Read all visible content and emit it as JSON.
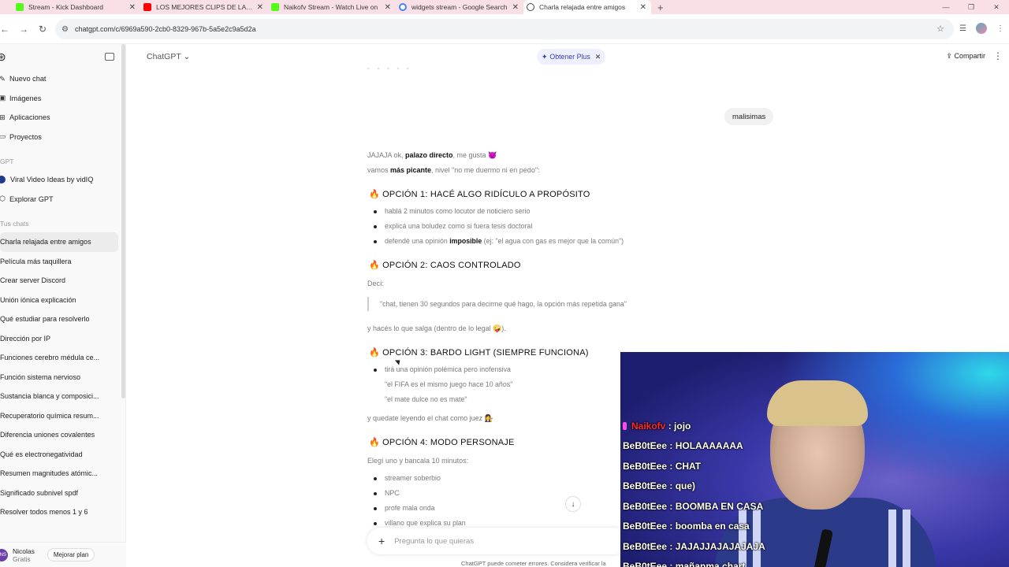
{
  "browser": {
    "tabs": [
      {
        "title": "Stream - Kick Dashboard",
        "icon": "kick-icon",
        "color": "#53fc18",
        "active": false
      },
      {
        "title": "LOS MEJORES CLIPS DE LA PXE",
        "icon": "youtube-icon",
        "color": "#ff0000",
        "active": false
      },
      {
        "title": "Naikofv Stream - Watch Live on",
        "icon": "kick-icon",
        "color": "#53fc18",
        "active": false
      },
      {
        "title": "widgets stream - Google Search",
        "icon": "google-icon",
        "color": "#4285f4",
        "active": false
      },
      {
        "title": "Charla relajada entre amigos",
        "icon": "chatgpt-icon",
        "color": "#444444",
        "active": true
      }
    ],
    "url": "chatgpt.com/c/6969a590-2cb0-8329-967b-5a5e2c9a5d2a"
  },
  "sidebar": {
    "nav": [
      {
        "label": "Nuevo chat",
        "icon": "edit-icon"
      },
      {
        "label": "Imágenes",
        "icon": "image-icon"
      },
      {
        "label": "Aplicaciones",
        "icon": "apps-icon"
      },
      {
        "label": "Proyectos",
        "icon": "folder-icon"
      }
    ],
    "gpt_section": "GPT",
    "gpts": [
      {
        "label": "Viral Video Ideas by vidIQ",
        "icon": "vidiq-icon"
      },
      {
        "label": "Explorar GPT",
        "icon": "explore-icon"
      }
    ],
    "chats_section": "Tus chats",
    "chats": [
      "Charla relajada entre amigos",
      "Película más taquillera",
      "Crear server Discord",
      "Unión iónica explicación",
      "Qué estudiar para resolverlo",
      "Dirección por IP",
      "Funciones cerebro médula ce...",
      "Función sistema nervioso",
      "Sustancia blanca y composici...",
      "Recuperatorio química resum...",
      "Diferencia uniones covalentes",
      "Qué es electronegatividad",
      "Resumen magnitudes atómic...",
      "Significado subnivel spdf",
      "Resolver todos menos 1 y 6"
    ],
    "user": {
      "name": "Nicolas",
      "plan": "Gratis",
      "initials": "NS"
    },
    "upgrade_label": "Mejorar plan"
  },
  "header": {
    "model": "ChatGPT",
    "plus_label": "Obtener Plus",
    "share_label": "Compartir"
  },
  "conversation": {
    "user_message": "malisimas",
    "intro1_a": "JAJAJA ok, ",
    "intro1_b": "palazo directo",
    "intro1_c": ", me gusta 😈",
    "intro2_a": "vamos ",
    "intro2_b": "más picante",
    "intro2_c": ", nivel \"no me duermo ni en pedo\":",
    "opt1_title": "OPCIÓN 1: HACÉ ALGO RIDÍCULO A PROPÓSITO",
    "opt1_items": [
      "hablá 2 minutos como locutor de noticiero serio",
      "explicá una boludez como si fuera tesis doctoral"
    ],
    "opt1_item3_a": "defendé una opinión ",
    "opt1_item3_b": "imposible",
    "opt1_item3_c": " (ej: \"el agua con gas es mejor que la común\")",
    "opt2_title": "OPCIÓN 2: CAOS CONTROLADO",
    "opt2_intro": "Decí:",
    "opt2_quote": "\"chat, tienen 30 segundos para decirme qué hago, la opción más repetida gana\"",
    "opt2_outro": "y hacés lo que salga (dentro de lo legal 🤪).",
    "opt3_title": "OPCIÓN 3: BARDO LIGHT (SIEMPRE FUNCIONA)",
    "opt3_items": [
      "tirá una opinión polémica pero inofensiva",
      "\"el FIFA es el mismo juego hace 10 años\"",
      "\"el mate dulce no es mate\""
    ],
    "opt3_outro": "y quedate leyendo el chat como juez 👩‍⚖️",
    "opt4_title": "OPCIÓN 4: MODO PERSONAJE",
    "opt4_intro": "Elegí uno y bancala 10 minutos:",
    "opt4_items": [
      "streamer soberbio",
      "NPC",
      "profe mala onda",
      "villano que explica su plan"
    ]
  },
  "composer": {
    "placeholder": "Pregunta lo que quieras",
    "disclaimer": "ChatGPT puede cometer errores. Considera verificar la"
  },
  "stream_chat": [
    {
      "user": "Naikofv",
      "msg": "jojo",
      "highlight": true
    },
    {
      "user": "BeB0tEee",
      "msg": "HOLAAAAAAA"
    },
    {
      "user": "BeB0tEee",
      "msg": "CHAT"
    },
    {
      "user": "BeB0tEee",
      "msg": "que)"
    },
    {
      "user": "BeB0tEee",
      "msg": "BOOMBA EN CASA"
    },
    {
      "user": "BeB0tEee",
      "msg": "boomba en casa"
    },
    {
      "user": "BeB0tEee",
      "msg": "JAJAJJAJAJAJAJA"
    },
    {
      "user": "BeB0tEee",
      "msg": "mañanma chart"
    }
  ],
  "colors": {
    "accent": "#3b3bb5",
    "sidebar_bg": "#f9f9f9",
    "tab_bg": "#f9dfe6"
  }
}
